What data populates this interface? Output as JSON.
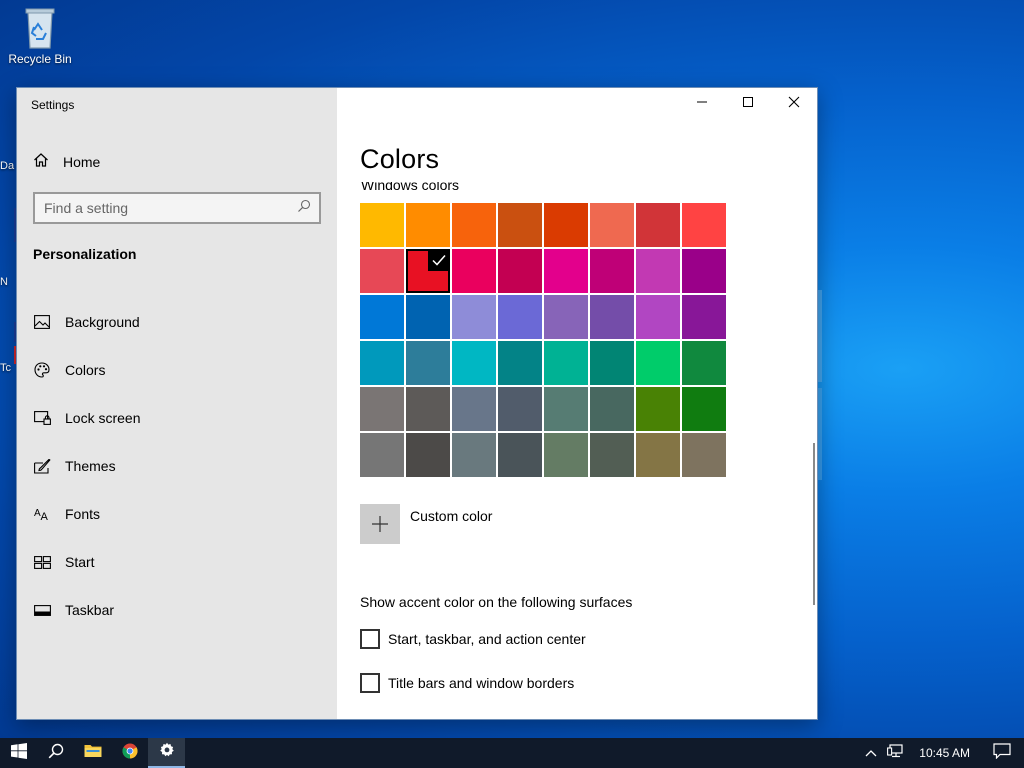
{
  "desktop": {
    "icons": [
      {
        "label": "Recycle Bin",
        "icon": "recycle-bin-icon"
      }
    ],
    "peek_texts": [
      "Da",
      "N",
      "Tc"
    ]
  },
  "settings_window": {
    "title": "Settings",
    "home_label": "Home",
    "search": {
      "placeholder": "Find a setting",
      "value": ""
    },
    "section": "Personalization",
    "nav_items": [
      {
        "label": "Background",
        "icon": "picture-icon"
      },
      {
        "label": "Colors",
        "icon": "palette-icon",
        "selected": true
      },
      {
        "label": "Lock screen",
        "icon": "lock-screen-icon"
      },
      {
        "label": "Themes",
        "icon": "themes-brush-icon"
      },
      {
        "label": "Fonts",
        "icon": "fonts-icon"
      },
      {
        "label": "Start",
        "icon": "start-grid-icon"
      },
      {
        "label": "Taskbar",
        "icon": "taskbar-icon"
      }
    ],
    "content": {
      "title": "Colors",
      "subheading": "Windows colors",
      "accent_swatches": [
        "#FFB900",
        "#FF8C00",
        "#F7630C",
        "#CA5010",
        "#DA3B01",
        "#EF6950",
        "#D13438",
        "#FF4343",
        "#E74856",
        "#E81123",
        "#EA005E",
        "#C30052",
        "#E3008C",
        "#BF0077",
        "#C239B3",
        "#9A0089",
        "#0078D7",
        "#0063B1",
        "#8E8CD8",
        "#6B69D6",
        "#8764B8",
        "#744DA9",
        "#B146C2",
        "#881798",
        "#0099BC",
        "#2D7D9A",
        "#00B7C3",
        "#038387",
        "#00B294",
        "#018574",
        "#00CC6A",
        "#10893E",
        "#7A7574",
        "#5D5A58",
        "#68768A",
        "#515C6B",
        "#567C73",
        "#486860",
        "#498205",
        "#107C10",
        "#767676",
        "#4C4A48",
        "#69797E",
        "#4A5459",
        "#647C64",
        "#525E54",
        "#847545",
        "#7E735F"
      ],
      "selected_swatch_index": 9,
      "custom_color_label": "Custom color",
      "surfaces_label": "Show accent color on the following surfaces",
      "checkboxes": [
        {
          "label": "Start, taskbar, and action center",
          "checked": false
        },
        {
          "label": "Title bars and window borders",
          "checked": false
        }
      ]
    },
    "title_buttons": [
      "minimize-icon",
      "maximize-icon",
      "close-icon"
    ]
  },
  "taskbar": {
    "buttons": [
      {
        "name": "start",
        "icon": "windows-logo-icon"
      },
      {
        "name": "search",
        "icon": "search-icon"
      },
      {
        "name": "file-explorer",
        "icon": "folder-icon"
      },
      {
        "name": "chrome",
        "icon": "chrome-icon"
      },
      {
        "name": "settings",
        "icon": "gear-icon",
        "active": true
      }
    ],
    "tray": {
      "time": "10:45 AM",
      "icons": [
        "chevron-up-icon",
        "network-icon",
        "notification-icon"
      ]
    }
  }
}
